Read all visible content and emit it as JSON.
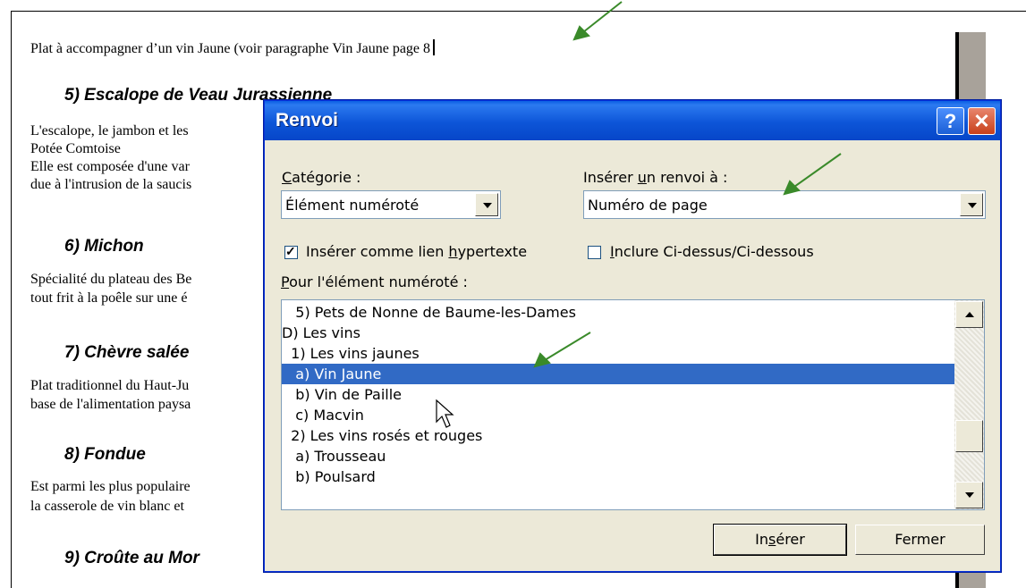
{
  "document": {
    "line1": "Plat à accompagner d’un vin Jaune (voir paragraphe Vin Jaune page 8",
    "heading5": "5) Escalope de Veau Jurassienne",
    "p5_line1": "L'escalope, le jambon et les",
    "p5_line2": "Potée Comtoise",
    "p5_line3": "Elle est composée d'une var",
    "p5_line4": "due à l'intrusion de la saucis",
    "heading6": "6) Michon",
    "p6_line1": "Spécialité du plateau des Be",
    "p6_line2": "tout frit à la poêle sur une é",
    "heading7": "7) Chèvre salée",
    "p7_line1": "Plat traditionnel du Haut-Ju",
    "p7_line2": "base de l'alimentation paysa",
    "heading8": "8) Fondue",
    "p8_line1": "Est parmi les plus populaire",
    "p8_line2": "la casserole de vin blanc et",
    "heading9": "9) Croûte au Mor"
  },
  "dialog": {
    "title": "Renvoi",
    "help_glyph": "?",
    "close_glyph": "✕",
    "category_label_u": "C",
    "category_label_rest": "atégorie :",
    "category_value": "Élément numéroté",
    "insert_ref_label_pre": "Insérer ",
    "insert_ref_label_u": "u",
    "insert_ref_label_post": "n renvoi à :",
    "insert_ref_value": "Numéro de page",
    "hyperlink_label_pre": "Insérer comme lien ",
    "hyperlink_label_u": "h",
    "hyperlink_label_post": "ypertexte",
    "hyperlink_checked": true,
    "above_below_u": "I",
    "above_below_rest": "nclure Ci-dessus/Ci-dessous",
    "above_below_checked": false,
    "for_item_label_u": "P",
    "for_item_label_rest": "our l'élément numéroté :",
    "list_items": [
      "   5) Pets de Nonne de Baume-les-Dames",
      "D) Les vins",
      "  1) Les vins jaunes",
      "   a) Vin Jaune",
      "   b) Vin de Paille",
      "   c) Macvin",
      "  2) Les vins rosés et rouges",
      "   a) Trousseau",
      "   b) Poulsard"
    ],
    "selected_index": 3,
    "insert_button_pre": "In",
    "insert_button_u": "s",
    "insert_button_post": "érer",
    "close_button": "Fermer"
  },
  "annotation_color": "#3a8a2a"
}
